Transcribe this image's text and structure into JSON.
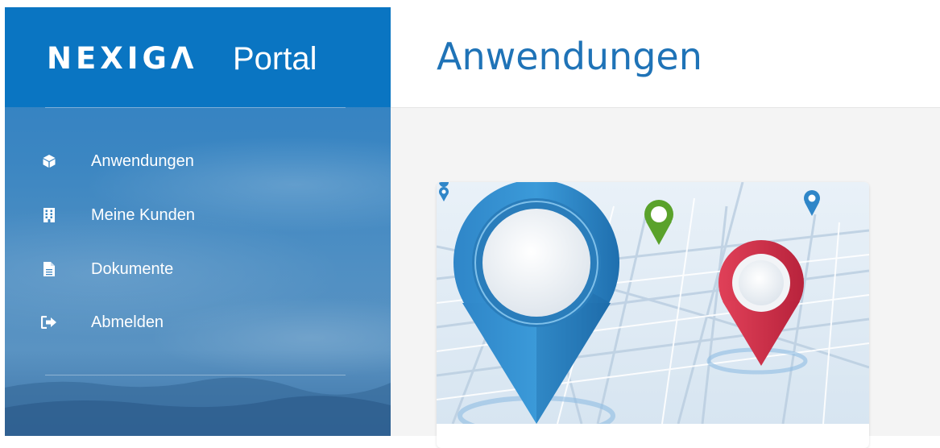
{
  "brand": {
    "logo_text": "NEXIGΛ",
    "portal_text": "Portal"
  },
  "sidebar": {
    "items": [
      {
        "label": "Anwendungen",
        "icon": "cube-icon"
      },
      {
        "label": "Meine Kunden",
        "icon": "building-icon"
      },
      {
        "label": "Dokumente",
        "icon": "document-icon"
      },
      {
        "label": "Abmelden",
        "icon": "sign-out-icon"
      }
    ]
  },
  "header": {
    "title": "Anwendungen"
  },
  "colors": {
    "brand_blue": "#0a75c2",
    "title_blue": "#1f73b7",
    "content_bg": "#f4f4f4"
  }
}
